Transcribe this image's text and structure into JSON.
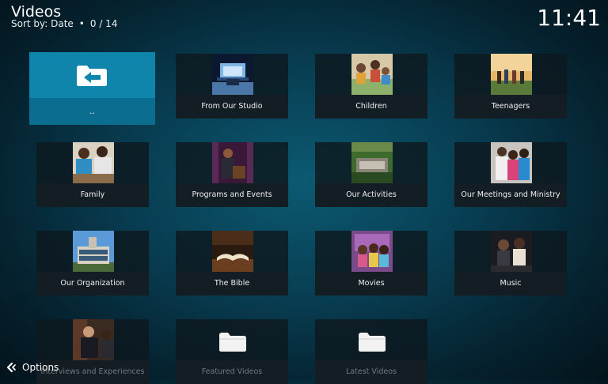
{
  "header": {
    "title": "Videos",
    "sort_label": "Sort by: Date",
    "count": "0 / 14"
  },
  "clock": "11:41",
  "tiles": [
    {
      "label": "..",
      "icon": "folder-back-icon"
    },
    {
      "label": "From Our Studio",
      "icon": "studio-thumbnail"
    },
    {
      "label": "Children",
      "icon": "children-thumbnail"
    },
    {
      "label": "Teenagers",
      "icon": "teenagers-thumbnail"
    },
    {
      "label": "Family",
      "icon": "family-thumbnail"
    },
    {
      "label": "Programs and Events",
      "icon": "programs-thumbnail"
    },
    {
      "label": "Our Activities",
      "icon": "activities-thumbnail"
    },
    {
      "label": "Our Meetings and Ministry",
      "icon": "meetings-thumbnail"
    },
    {
      "label": "Our Organization",
      "icon": "organization-thumbnail"
    },
    {
      "label": "The Bible",
      "icon": "bible-thumbnail"
    },
    {
      "label": "Movies",
      "icon": "movies-thumbnail"
    },
    {
      "label": "Music",
      "icon": "music-thumbnail"
    },
    {
      "label": "Interviews and Experiences",
      "icon": "interviews-thumbnail"
    },
    {
      "label": "Featured Videos",
      "icon": "folder-icon"
    },
    {
      "label": "Latest Videos",
      "icon": "folder-icon"
    }
  ],
  "footer": {
    "options_label": "Options",
    "icon": "options-arrow-icon"
  },
  "colors": {
    "focus": "#0f85ab",
    "tile_bg": "#0e181e",
    "background": "#0b5a72"
  }
}
